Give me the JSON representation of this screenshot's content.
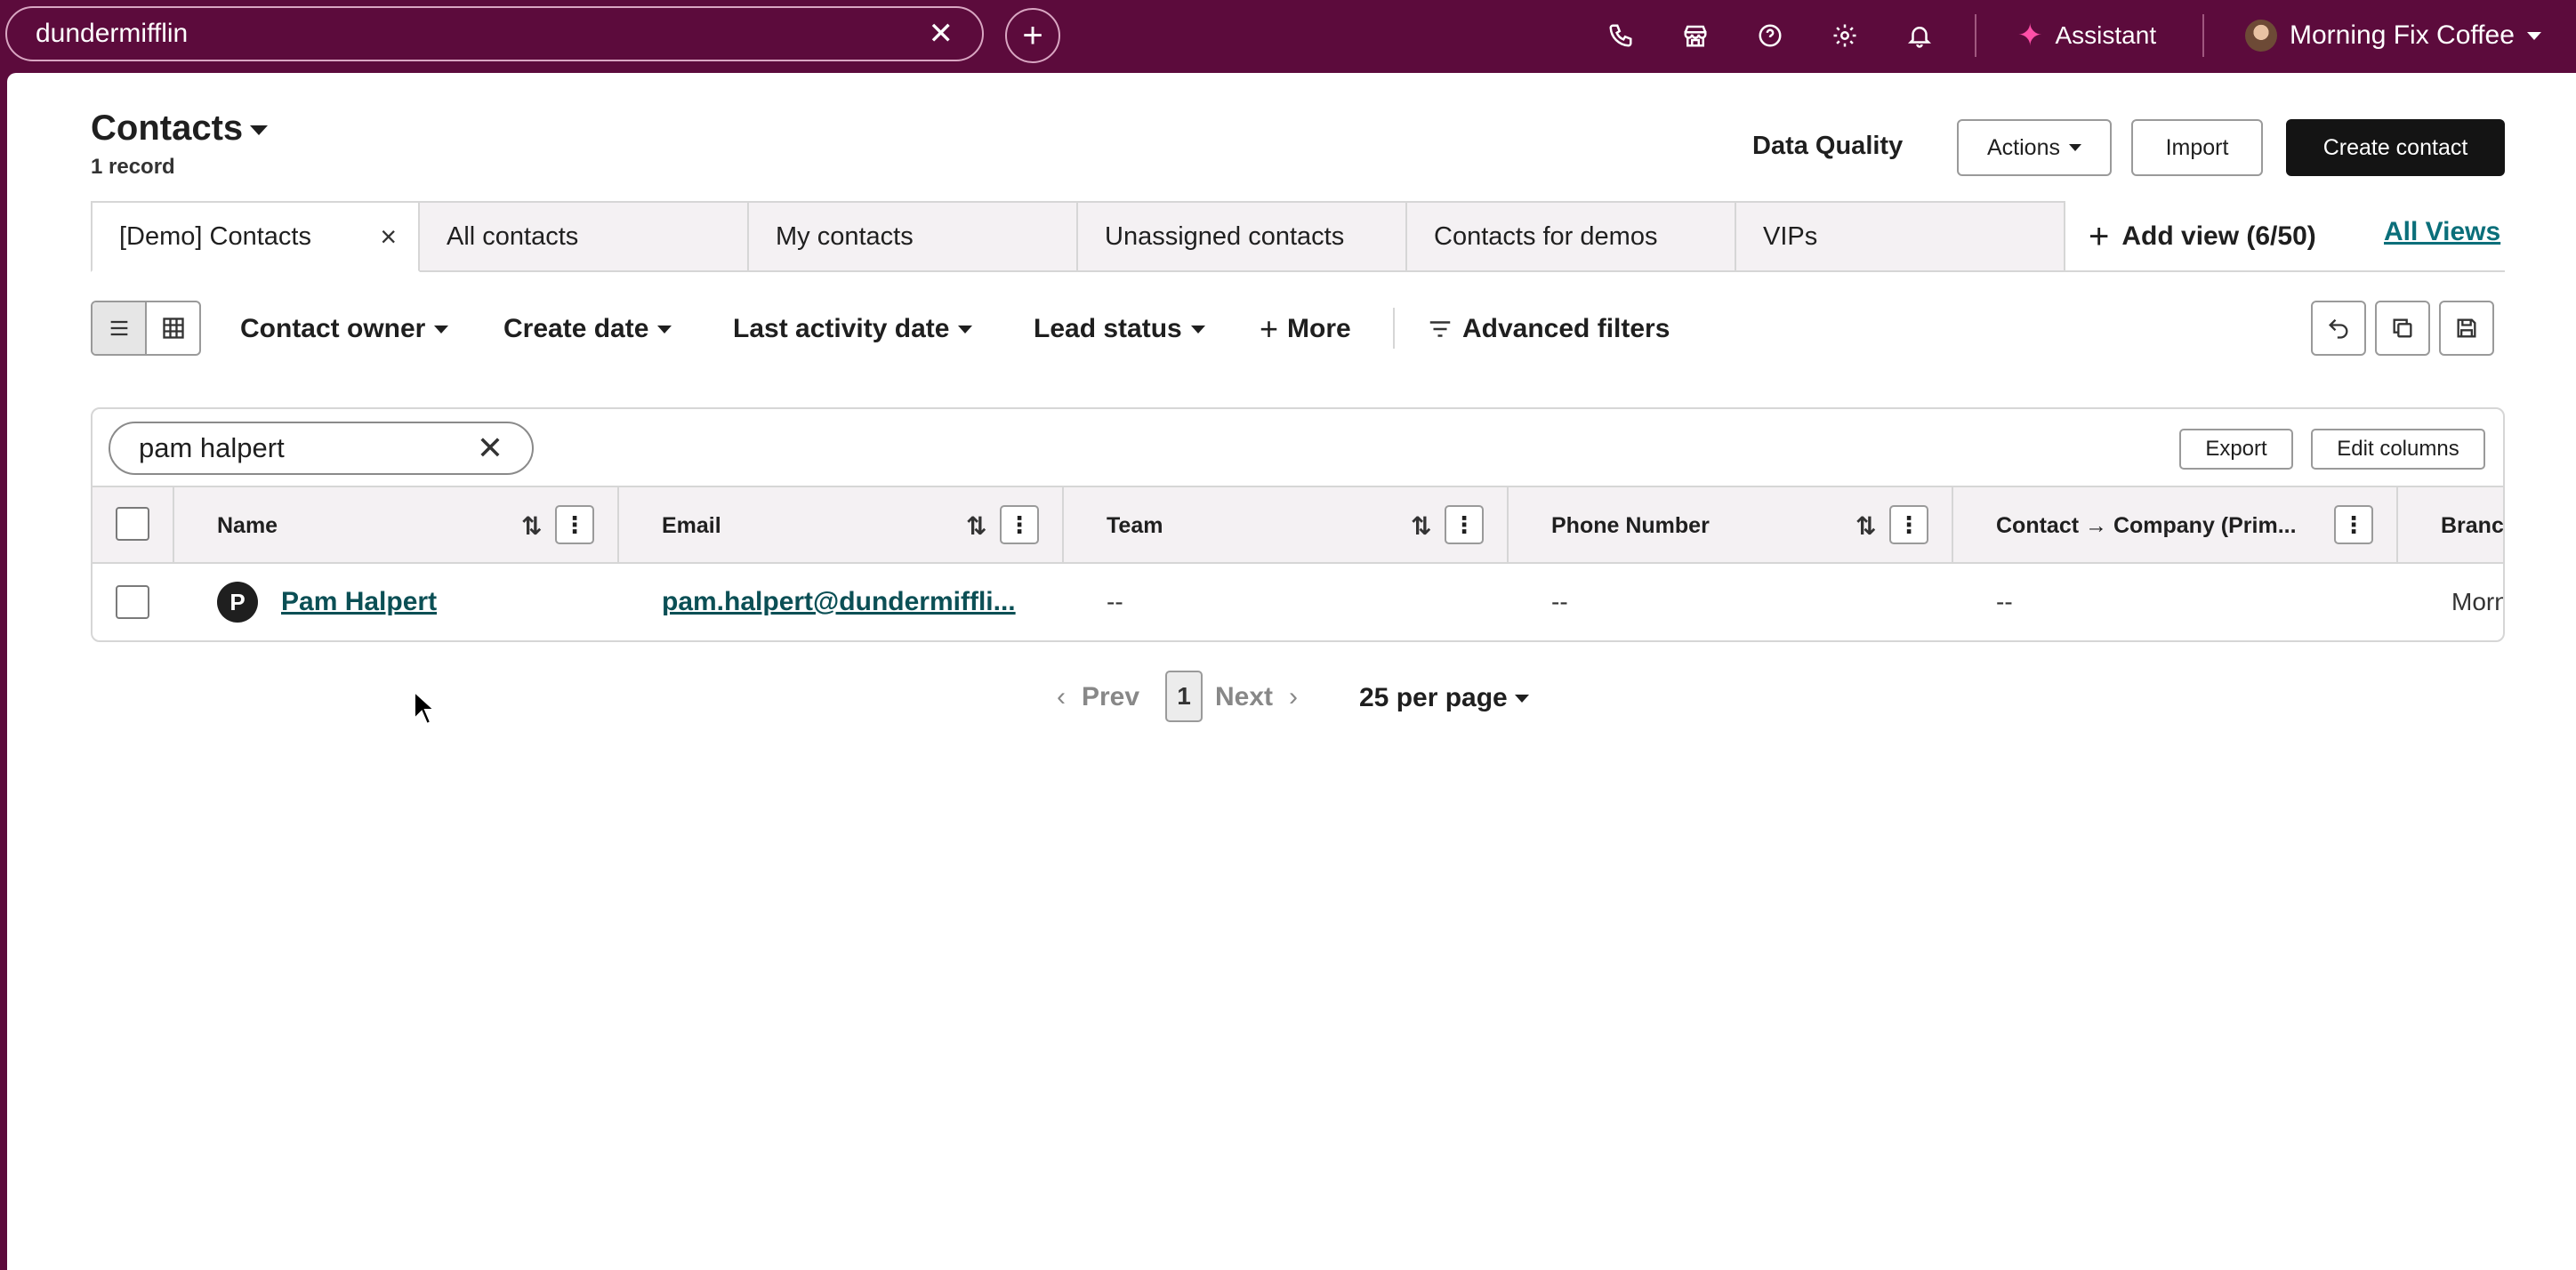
{
  "topbar": {
    "search_value": "dundermifflin",
    "assistant_label": "Assistant",
    "account_name": "Morning Fix Coffee",
    "icons": [
      "phone-icon",
      "marketplace-icon",
      "help-icon",
      "settings-icon",
      "notifications-icon"
    ]
  },
  "header": {
    "title": "Contacts",
    "record_count": "1 record",
    "data_quality": "Data Quality",
    "actions_label": "Actions",
    "import_label": "Import",
    "create_label": "Create contact"
  },
  "views": {
    "tabs": [
      "[Demo] Contacts",
      "All contacts",
      "My contacts",
      "Unassigned contacts",
      "Contacts for demos",
      "VIPs"
    ],
    "add_view_label": "Add view (6/50)",
    "all_views_label": "All Views"
  },
  "filters": {
    "contact_owner": "Contact owner",
    "create_date": "Create date",
    "last_activity": "Last activity date",
    "lead_status": "Lead status",
    "more": "More",
    "advanced": "Advanced filters"
  },
  "table": {
    "search_value": "pam halpert",
    "export_label": "Export",
    "edit_columns_label": "Edit columns",
    "columns": [
      "Name",
      "Email",
      "Team",
      "Phone Number",
      "Contact → Company (Prim...",
      "Branc"
    ],
    "rows": [
      {
        "avatar_letter": "P",
        "name": "Pam Halpert",
        "email": "pam.halpert@dundermiffli...",
        "team": "--",
        "phone": "--",
        "company": "--",
        "brand": "Morn"
      }
    ]
  },
  "pagination": {
    "prev": "Prev",
    "page": "1",
    "next": "Next",
    "per_page": "25 per page"
  },
  "colors": {
    "topbar": "#5c0b3c",
    "link": "#0b4f55",
    "assistant_spark": "#ff4fa8"
  }
}
